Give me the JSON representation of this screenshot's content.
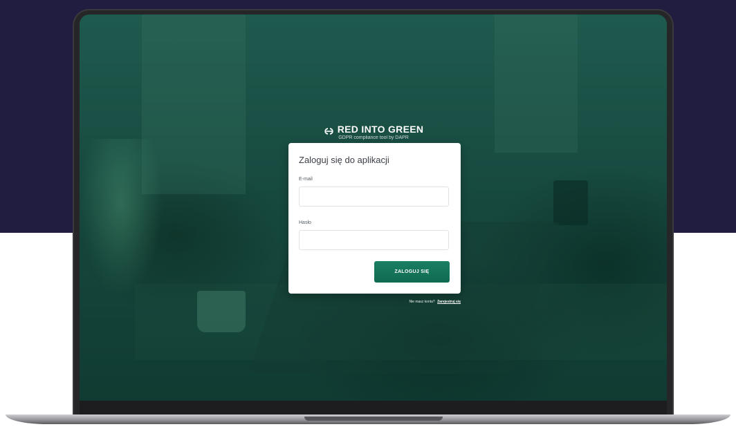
{
  "app": {
    "logo_title": "RED INTO GREEN",
    "logo_subtitle": "GDPR compliance tool by DAPR",
    "logo_icon": "cd-logo-icon"
  },
  "login": {
    "title": "Zaloguj się do aplikacji",
    "email_label": "E-mail",
    "email_value": "",
    "email_placeholder": "",
    "password_label": "Hasło",
    "password_value": "",
    "password_placeholder": "",
    "submit_label": "ZALOGUJ SIĘ"
  },
  "register": {
    "prompt": "Nie masz konta?",
    "link_label": "Zarejestruj się"
  },
  "colors": {
    "brand_green": "#1a7f63",
    "background_top": "#201d40",
    "screen_tint": "#17493f"
  }
}
